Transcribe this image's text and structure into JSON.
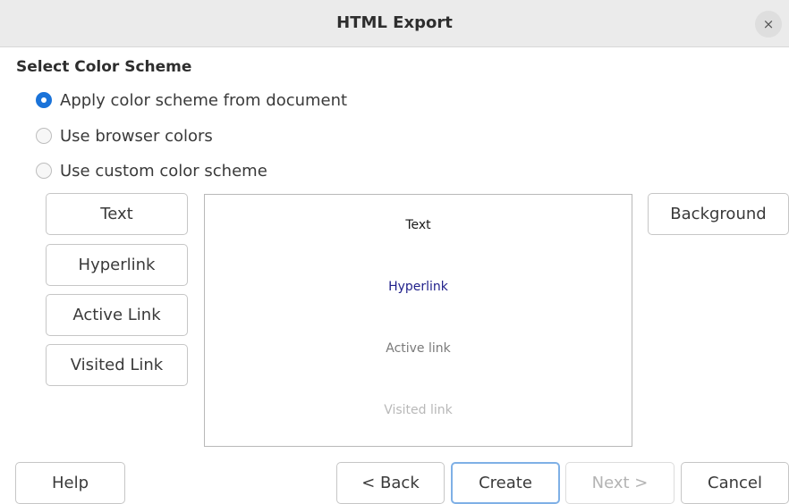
{
  "window": {
    "title": "HTML Export",
    "close_glyph": "×"
  },
  "section": {
    "heading": "Select Color Scheme"
  },
  "options": [
    {
      "label": "Apply color scheme from document",
      "checked": true
    },
    {
      "label": "Use browser colors",
      "checked": false
    },
    {
      "label": "Use custom color scheme",
      "checked": false
    }
  ],
  "color_buttons": {
    "text": "Text",
    "hyperlink": "Hyperlink",
    "active_link": "Active Link",
    "visited_link": "Visited Link",
    "background": "Background"
  },
  "preview": {
    "text": "Text",
    "hyperlink": "Hyperlink",
    "active_link": "Active link",
    "visited_link": "Visited link",
    "colors": {
      "text": "#1a1a1a",
      "hyperlink": "#1f1f8a",
      "active_link": "#7a7a7a",
      "visited_link": "#b8b8b8"
    }
  },
  "footer": {
    "help": "Help",
    "back": "< Back",
    "create": "Create",
    "next": "Next >",
    "cancel": "Cancel"
  },
  "accent_color": "#1a73d9"
}
